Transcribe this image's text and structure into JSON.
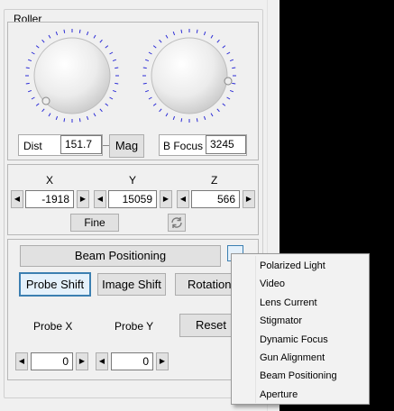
{
  "group_title": "Roller",
  "rollers": {
    "dist_label": "Dist",
    "dist_value": "151.7",
    "mag_button": "Mag",
    "bfocus_label": "B Focus",
    "bfocus_value": "3245"
  },
  "position": {
    "x_label": "X",
    "y_label": "Y",
    "z_label": "Z",
    "x_value": "-1918",
    "y_value": "15059",
    "z_value": "566",
    "fine_button": "Fine"
  },
  "beam": {
    "header_button": "Beam Positioning",
    "tabs": [
      "Probe Shift",
      "Image Shift",
      "Rotation"
    ],
    "probe_x_label": "Probe X",
    "probe_y_label": "Probe Y",
    "reset_button": "Reset",
    "probe_x_value": "0",
    "probe_y_value": "0"
  },
  "context_menu": {
    "items": [
      "Polarized Light",
      "Video",
      "Lens Current",
      "Stigmator",
      "Dynamic Focus",
      "Gun Alignment",
      "Beam Positioning",
      "Aperture"
    ]
  },
  "icons": {
    "left_arrow": "left-arrow-icon",
    "right_arrow": "right-arrow-icon",
    "refresh": "refresh-icon"
  },
  "colors": {
    "panel_background": "#f0f0f0",
    "selected_border": "#3c7fb1",
    "knob_tick": "#2b2bd6"
  }
}
